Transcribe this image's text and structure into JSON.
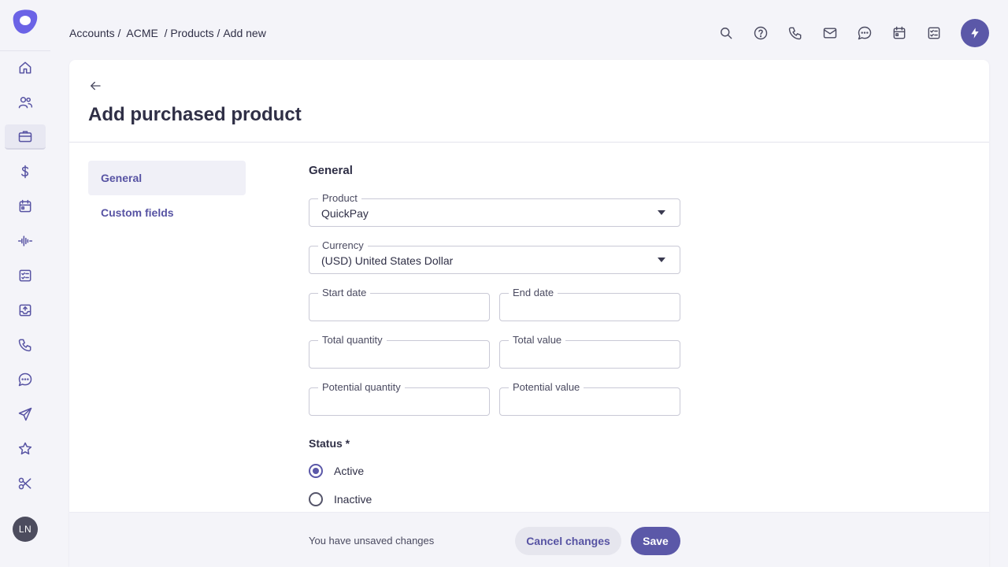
{
  "breadcrumb": [
    {
      "label": "Accounts / "
    },
    {
      "label": " ACME "
    },
    {
      "label": " / Products / "
    },
    {
      "label": "Add new"
    }
  ],
  "sidebar": {
    "items": [
      {
        "icon": "home-icon"
      },
      {
        "icon": "users-icon"
      },
      {
        "icon": "briefcase-icon",
        "active": true
      },
      {
        "icon": "dollar-icon"
      },
      {
        "icon": "calendar-icon"
      },
      {
        "icon": "activity-icon"
      },
      {
        "icon": "checklist-icon"
      },
      {
        "icon": "inbox-upload-icon"
      },
      {
        "icon": "phone-icon"
      },
      {
        "icon": "chat-icon"
      },
      {
        "icon": "send-icon"
      },
      {
        "icon": "star-icon"
      },
      {
        "icon": "scissors-icon"
      }
    ],
    "avatar": "LN"
  },
  "topbar": {
    "icons": [
      "search-icon",
      "help-icon",
      "phone-icon",
      "mail-icon",
      "chat-icon",
      "calendar-icon",
      "checklist-icon"
    ],
    "action_icon": "flash-icon"
  },
  "page": {
    "title": "Add purchased product",
    "tabs": [
      {
        "label": "General",
        "active": true
      },
      {
        "label": "Custom fields",
        "active": false
      }
    ]
  },
  "form": {
    "section_title": "General",
    "product": {
      "label": "Product",
      "value": "QuickPay"
    },
    "currency": {
      "label": "Currency",
      "value": "(USD) United States Dollar"
    },
    "start_date": {
      "label": "Start date",
      "value": ""
    },
    "end_date": {
      "label": "End date",
      "value": ""
    },
    "total_quantity": {
      "label": "Total quantity",
      "value": ""
    },
    "total_value": {
      "label": "Total value",
      "value": ""
    },
    "potential_quantity": {
      "label": "Potential quantity",
      "value": ""
    },
    "potential_value": {
      "label": "Potential value",
      "value": ""
    },
    "status": {
      "label": "Status *",
      "options": [
        {
          "label": "Active",
          "checked": true
        },
        {
          "label": "Inactive",
          "checked": false
        }
      ]
    }
  },
  "footer": {
    "unsaved_text": "You have unsaved changes",
    "cancel_label": "Cancel changes",
    "save_label": "Save"
  },
  "colors": {
    "accent": "#5b58a8",
    "text": "#2f2f46",
    "background": "#f4f4f9"
  }
}
